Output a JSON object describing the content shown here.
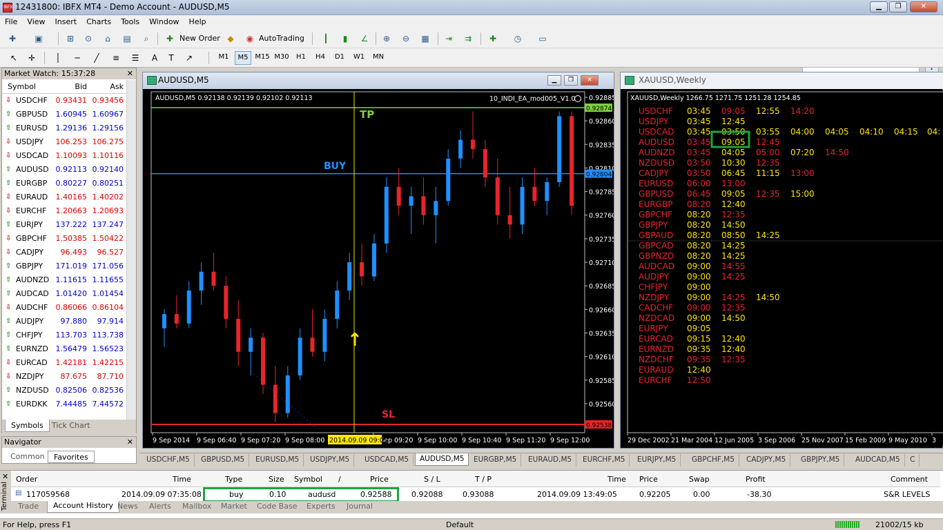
{
  "window": {
    "title": "12431800: IBFX MT4 - Demo Account - AUDUSD,M5",
    "app_badge": "IBFX"
  },
  "menu": [
    "File",
    "View",
    "Insert",
    "Charts",
    "Tools",
    "Window",
    "Help"
  ],
  "toolbar": {
    "new_order": "New Order",
    "autotrading": "AutoTrading"
  },
  "timeframes": [
    "M1",
    "M5",
    "M15",
    "M30",
    "H1",
    "H4",
    "D1",
    "W1",
    "MN"
  ],
  "selected_timeframe": "M5",
  "market_watch": {
    "title": "Market Watch: 15:37:28",
    "cols": {
      "symbol": "Symbol",
      "bid": "Bid",
      "ask": "Ask"
    },
    "rows": [
      {
        "s": "USDCHF",
        "b": "0.93431",
        "a": "0.93456",
        "d": "dn"
      },
      {
        "s": "GBPUSD",
        "b": "1.60945",
        "a": "1.60967",
        "d": "up"
      },
      {
        "s": "EURUSD",
        "b": "1.29136",
        "a": "1.29156",
        "d": "up"
      },
      {
        "s": "USDJPY",
        "b": "106.253",
        "a": "106.275",
        "d": "dn"
      },
      {
        "s": "USDCAD",
        "b": "1.10093",
        "a": "1.10116",
        "d": "dn"
      },
      {
        "s": "AUDUSD",
        "b": "0.92113",
        "a": "0.92140",
        "d": "up"
      },
      {
        "s": "EURGBP",
        "b": "0.80227",
        "a": "0.80251",
        "d": "up"
      },
      {
        "s": "EURAUD",
        "b": "1.40165",
        "a": "1.40202",
        "d": "dn"
      },
      {
        "s": "EURCHF",
        "b": "1.20663",
        "a": "1.20693",
        "d": "dn"
      },
      {
        "s": "EURJPY",
        "b": "137.222",
        "a": "137.247",
        "d": "up"
      },
      {
        "s": "GBPCHF",
        "b": "1.50385",
        "a": "1.50422",
        "d": "dn"
      },
      {
        "s": "CADJPY",
        "b": "96.493",
        "a": "96.527",
        "d": "dn"
      },
      {
        "s": "GBPJPY",
        "b": "171.019",
        "a": "171.056",
        "d": "up"
      },
      {
        "s": "AUDNZD",
        "b": "1.11615",
        "a": "1.11655",
        "d": "up"
      },
      {
        "s": "AUDCAD",
        "b": "1.01420",
        "a": "1.01454",
        "d": "up"
      },
      {
        "s": "AUDCHF",
        "b": "0.86066",
        "a": "0.86104",
        "d": "dn"
      },
      {
        "s": "AUDJPY",
        "b": "97.880",
        "a": "97.914",
        "d": "up"
      },
      {
        "s": "CHFJPY",
        "b": "113.703",
        "a": "113.738",
        "d": "up"
      },
      {
        "s": "EURNZD",
        "b": "1.56479",
        "a": "1.56523",
        "d": "up"
      },
      {
        "s": "EURCAD",
        "b": "1.42181",
        "a": "1.42215",
        "d": "dn"
      },
      {
        "s": "NZDJPY",
        "b": "87.675",
        "a": "87.710",
        "d": "dn"
      },
      {
        "s": "NZDUSD",
        "b": "0.82506",
        "a": "0.82536",
        "d": "up"
      },
      {
        "s": "EURDKK",
        "b": "7.44485",
        "a": "7.44572",
        "d": "up"
      }
    ],
    "tabs": [
      "Symbols",
      "Tick Chart"
    ]
  },
  "navigator": {
    "title": "Navigator",
    "tabs": [
      "Common",
      "Favorites"
    ]
  },
  "chart1": {
    "window_title": "AUDUSD,M5",
    "info": "AUDUSD,M5  0.92138 0.92139 0.92102 0.92113",
    "ea_label": "10_INDI_EA_mod005_V1.0",
    "tp_label": "TP",
    "buy_label": "BUY",
    "sl_label": "SL",
    "price_ticks": [
      "0.92885",
      "0.92860",
      "0.92835",
      "0.92810",
      "0.92785",
      "0.92760",
      "0.92735",
      "0.92710",
      "0.92685",
      "0.92660",
      "0.92635",
      "0.92610",
      "0.92585",
      "0.92560"
    ],
    "tp_price": "0.92874",
    "buy_price": "0.92804",
    "sl_price": "0.92538",
    "time_ticks": [
      "9 Sep 2014",
      "9 Sep 06:40",
      "9 Sep 07:20",
      "9 Sep 08:00",
      "9 Sep 09:20",
      "9 Sep 10:00",
      "9 Sep 10:40",
      "9 Sep 11:20",
      "9 Sep 12:00"
    ],
    "cursor_time": "2014.09.09 09:05",
    "colors": {
      "bull": "#1e90ff",
      "bear": "#e8242b",
      "tp": "#7fd13b",
      "buy": "#1e90ff",
      "sl": "#e8242b",
      "vline": "#e8e800"
    }
  },
  "chart_data": {
    "type": "candlestick",
    "series": [
      {
        "name": "AUDUSD,M5",
        "ohlc": [
          [
            0.9264,
            0.9266,
            0.9262,
            0.92655
          ],
          [
            0.92655,
            0.92675,
            0.9264,
            0.92645
          ],
          [
            0.92645,
            0.9269,
            0.9264,
            0.9268
          ],
          [
            0.9268,
            0.9271,
            0.92665,
            0.927
          ],
          [
            0.927,
            0.9272,
            0.9268,
            0.92685
          ],
          [
            0.92685,
            0.92695,
            0.9264,
            0.9265
          ],
          [
            0.9265,
            0.9267,
            0.926,
            0.92615
          ],
          [
            0.92615,
            0.9264,
            0.9259,
            0.9263
          ],
          [
            0.9263,
            0.92635,
            0.9257,
            0.9258
          ],
          [
            0.9258,
            0.926,
            0.9254,
            0.9255
          ],
          [
            0.9255,
            0.926,
            0.92545,
            0.9259
          ],
          [
            0.9259,
            0.9264,
            0.92585,
            0.9263
          ],
          [
            0.9263,
            0.9266,
            0.9261,
            0.92615
          ],
          [
            0.92615,
            0.9266,
            0.92605,
            0.9265
          ],
          [
            0.9265,
            0.9269,
            0.9264,
            0.9268
          ],
          [
            0.9268,
            0.9272,
            0.9267,
            0.9271
          ],
          [
            0.9271,
            0.9273,
            0.92685,
            0.92695
          ],
          [
            0.92695,
            0.9274,
            0.9269,
            0.9273
          ],
          [
            0.9273,
            0.928,
            0.9272,
            0.9279
          ],
          [
            0.9279,
            0.9281,
            0.9276,
            0.9277
          ],
          [
            0.9277,
            0.9279,
            0.9274,
            0.9278
          ],
          [
            0.9278,
            0.928,
            0.9275,
            0.9276
          ],
          [
            0.9276,
            0.9279,
            0.9273,
            0.92775
          ],
          [
            0.92775,
            0.9283,
            0.9277,
            0.9282
          ],
          [
            0.9282,
            0.9285,
            0.9281,
            0.9284
          ],
          [
            0.9284,
            0.9287,
            0.9282,
            0.9283
          ],
          [
            0.9283,
            0.9284,
            0.9279,
            0.928
          ],
          [
            0.928,
            0.9282,
            0.9275,
            0.9276
          ],
          [
            0.9276,
            0.9279,
            0.92735,
            0.9275
          ],
          [
            0.9275,
            0.928,
            0.9274,
            0.9279
          ],
          [
            0.9279,
            0.9281,
            0.9277,
            0.92775
          ],
          [
            0.92775,
            0.928,
            0.9276,
            0.92795
          ],
          [
            0.92795,
            0.9287,
            0.9279,
            0.92865
          ],
          [
            0.92865,
            0.9287,
            0.9276,
            0.9277
          ]
        ]
      }
    ],
    "ylim": [
      0.92538,
      0.92885
    ]
  },
  "chart2": {
    "window_title": "XAUUSD,Weekly",
    "info": "XAUUSD,Weekly  1266.75 1271.75 1251.28 1254.85",
    "table": [
      {
        "p": "USDCHF",
        "t": [
          [
            "03:45",
            "y"
          ],
          [
            "09:05",
            "r"
          ],
          [
            "12:55",
            "y"
          ],
          [
            "14:20",
            "r"
          ]
        ]
      },
      {
        "p": "USDJPY",
        "t": [
          [
            "03:45",
            "y"
          ],
          [
            "12:45",
            "y"
          ]
        ]
      },
      {
        "p": "USDCAD",
        "t": [
          [
            "03:45",
            "y"
          ],
          [
            "03:50",
            "y"
          ],
          [
            "03:55",
            "y"
          ],
          [
            "04:00",
            "y"
          ],
          [
            "04:05",
            "y"
          ],
          [
            "04:10",
            "y"
          ],
          [
            "04:15",
            "y"
          ],
          [
            "04:",
            "y"
          ]
        ]
      },
      {
        "p": "AUDUSD",
        "t": [
          [
            "03:45",
            "r"
          ],
          [
            "09:05",
            "y"
          ],
          [
            "12:45",
            "r"
          ]
        ]
      },
      {
        "p": "AUDNZD",
        "t": [
          [
            "03:45",
            "r"
          ],
          [
            "04:05",
            "y"
          ],
          [
            "05:00",
            "r"
          ],
          [
            "07:20",
            "y"
          ],
          [
            "14:50",
            "r"
          ]
        ]
      },
      {
        "p": "NZDUSD",
        "t": [
          [
            "03:50",
            "r"
          ],
          [
            "10:30",
            "y"
          ],
          [
            "12:35",
            "r"
          ]
        ]
      },
      {
        "p": "CADJPY",
        "t": [
          [
            "03:50",
            "r"
          ],
          [
            "06:45",
            "y"
          ],
          [
            "11:15",
            "y"
          ],
          [
            "13:00",
            "r"
          ]
        ]
      },
      {
        "p": "EURUSD",
        "t": [
          [
            "06:00",
            "r"
          ],
          [
            "13:00",
            "r"
          ]
        ]
      },
      {
        "p": "GBPUSD",
        "t": [
          [
            "06:45",
            "r"
          ],
          [
            "09:05",
            "y"
          ],
          [
            "12:35",
            "r"
          ],
          [
            "15:00",
            "y"
          ]
        ]
      },
      {
        "p": "EURGBP",
        "t": [
          [
            "08:20",
            "r"
          ],
          [
            "12:40",
            "y"
          ]
        ]
      },
      {
        "p": "GBPCHF",
        "t": [
          [
            "08:20",
            "y"
          ],
          [
            "12:35",
            "r"
          ]
        ]
      },
      {
        "p": "GBPJPY",
        "t": [
          [
            "08:20",
            "y"
          ],
          [
            "14:50",
            "y"
          ]
        ]
      },
      {
        "p": "GBPAUD",
        "t": [
          [
            "08:20",
            "y"
          ],
          [
            "08:50",
            "y"
          ],
          [
            "14:25",
            "y"
          ]
        ]
      },
      {
        "p": "GBPCAD",
        "t": [
          [
            "08:20",
            "y"
          ],
          [
            "14:25",
            "y"
          ]
        ]
      },
      {
        "p": "GBPNZD",
        "t": [
          [
            "08:20",
            "y"
          ],
          [
            "14:25",
            "y"
          ]
        ]
      },
      {
        "p": "AUDCAD",
        "t": [
          [
            "09:00",
            "y"
          ],
          [
            "14:55",
            "r"
          ]
        ]
      },
      {
        "p": "AUDJPY",
        "t": [
          [
            "09:00",
            "y"
          ],
          [
            "14:25",
            "r"
          ]
        ]
      },
      {
        "p": "CHFJPY",
        "t": [
          [
            "09:00",
            "y"
          ]
        ]
      },
      {
        "p": "NZDJPY",
        "t": [
          [
            "09:00",
            "y"
          ],
          [
            "14:25",
            "r"
          ],
          [
            "14:50",
            "y"
          ]
        ]
      },
      {
        "p": "CADCHF",
        "t": [
          [
            "09:00",
            "r"
          ],
          [
            "12:35",
            "r"
          ]
        ]
      },
      {
        "p": "NZDCAD",
        "t": [
          [
            "09:00",
            "y"
          ],
          [
            "14:50",
            "y"
          ]
        ]
      },
      {
        "p": "EURJPY",
        "t": [
          [
            "09:05",
            "y"
          ]
        ]
      },
      {
        "p": "EURCAD",
        "t": [
          [
            "09:15",
            "y"
          ],
          [
            "12:40",
            "y"
          ]
        ]
      },
      {
        "p": "EURNZD",
        "t": [
          [
            "09:35",
            "y"
          ],
          [
            "12:40",
            "y"
          ]
        ]
      },
      {
        "p": "NZDCHF",
        "t": [
          [
            "09:35",
            "r"
          ],
          [
            "12:35",
            "r"
          ]
        ]
      },
      {
        "p": "EURAUD",
        "t": [
          [
            "12:40",
            "y"
          ]
        ]
      },
      {
        "p": "EURCHF",
        "t": [
          [
            "12:50",
            "r"
          ]
        ]
      }
    ],
    "time_ticks": [
      "29 Dec 2002",
      "21 Mar 2004",
      "12 Jun 2005",
      "3 Sep 2006",
      "25 Nov 2007",
      "15 Feb 2009",
      "9 May 2010",
      "3"
    ]
  },
  "chart_tabs": [
    "USDCHF,M5",
    "GBPUSD,M5",
    "EURUSD,M5",
    "USDJPY,M5",
    "USDCAD,M5",
    "AUDUSD,M5",
    "EURGBP,M5",
    "EURAUD,M5",
    "EURCHF,M5",
    "EURJPY,M5",
    "GBPCHF,M5",
    "CADJPY,M5",
    "GBPJPY,M5",
    "AUDCAD,M5",
    "C"
  ],
  "active_chart_tab": "AUDUSD,M5",
  "terminal": {
    "side_label": "Terminal",
    "headers": {
      "order": "Order",
      "time": "Time",
      "type": "Type",
      "size": "Size",
      "symbol": "Symbol",
      "sort": "/",
      "price": "Price",
      "sl": "S / L",
      "tp": "T / P",
      "time2": "Time",
      "price2": "Price",
      "swap": "Swap",
      "profit": "Profit",
      "comment": "Comment"
    },
    "row": {
      "order": "117059568",
      "time": "2014.09.09 07:35:08",
      "type": "buy",
      "size": "0.10",
      "symbol": "audusd",
      "price": "0.92588",
      "sl": "0.92088",
      "tp": "0.93088",
      "time2": "2014.09.09 13:49:05",
      "price2": "0.92205",
      "swap": "0.00",
      "profit": "-38.30",
      "comment": "S&R LEVELS"
    },
    "tabs": [
      "Trade",
      "Account History",
      "News",
      "Alerts",
      "Mailbox",
      "Market",
      "Code Base",
      "Experts",
      "Journal"
    ],
    "active_tab": "Account History"
  },
  "status": {
    "help": "For Help, press F1",
    "profile": "Default",
    "traffic": "21002/15 kb"
  }
}
